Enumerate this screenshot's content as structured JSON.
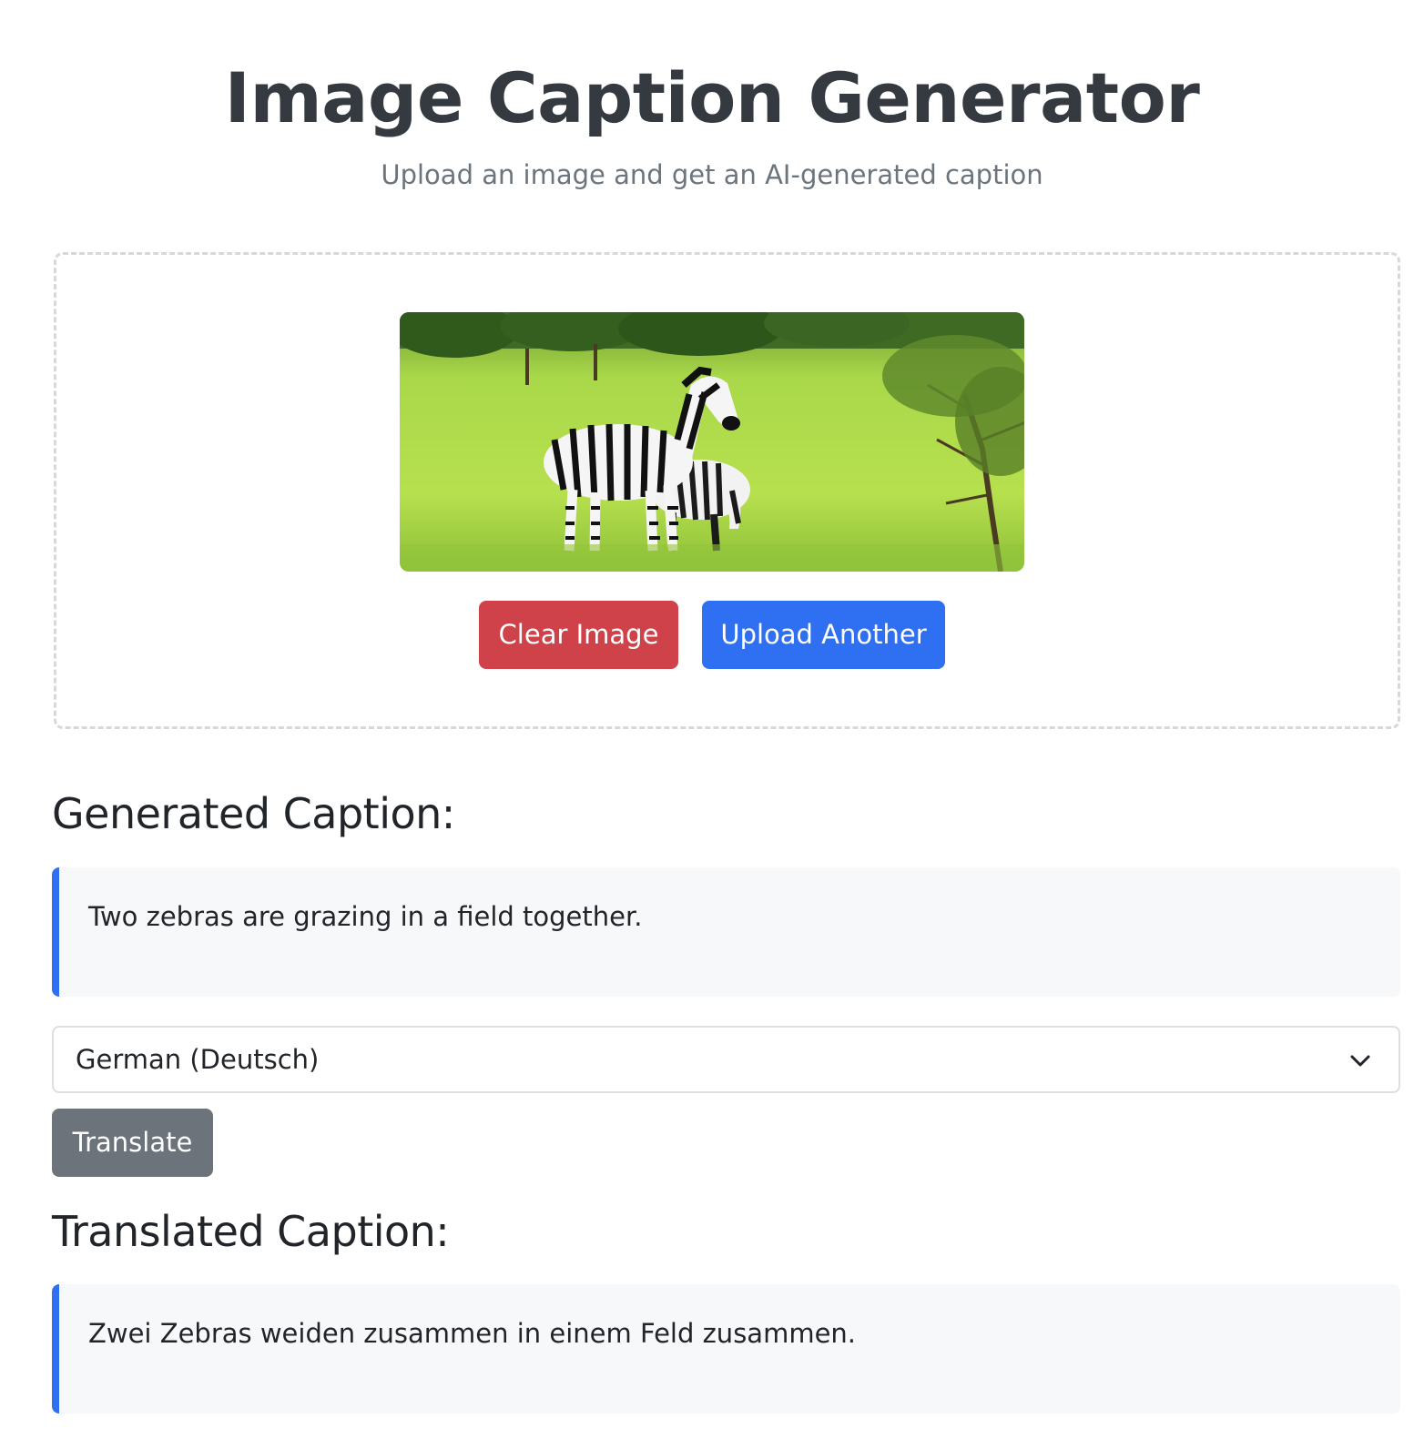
{
  "header": {
    "title": "Image Caption Generator",
    "subtitle": "Upload an image and get an AI-generated caption"
  },
  "upload": {
    "clear_label": "Clear Image",
    "upload_another_label": "Upload Another"
  },
  "generated": {
    "heading": "Generated Caption:",
    "text": "Two zebras are grazing in a field together."
  },
  "translation": {
    "selected_language": "German (Deutsch)",
    "translate_label": "Translate",
    "heading": "Translated Caption:",
    "text": "Zwei Zebras weiden zusammen in einem Feld zusammen."
  },
  "colors": {
    "accent": "#2f6ff1",
    "danger": "#cf4249",
    "secondary": "#6c737b",
    "title": "#343a40",
    "caption_bg": "#f7f8fa"
  },
  "icons": {
    "select_arrow": "chevron-down-icon"
  }
}
